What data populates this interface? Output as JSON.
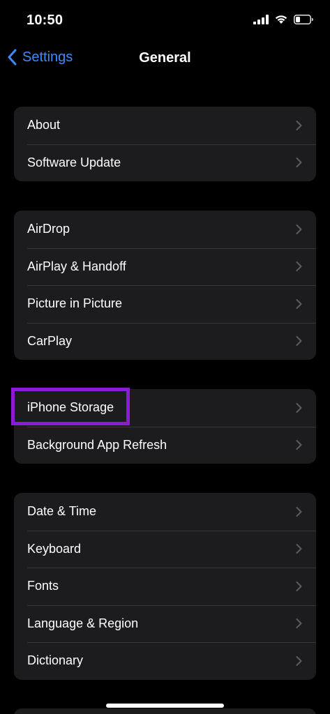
{
  "status_bar": {
    "time": "10:50",
    "icons": [
      "cellular-signal-icon",
      "wifi-icon",
      "battery-icon"
    ]
  },
  "nav": {
    "back_label": "Settings",
    "title": "General",
    "accent_color": "#3e8bff"
  },
  "groups": [
    {
      "items": [
        "About",
        "Software Update"
      ]
    },
    {
      "items": [
        "AirDrop",
        "AirPlay & Handoff",
        "Picture in Picture",
        "CarPlay"
      ]
    },
    {
      "items": [
        "iPhone Storage",
        "Background App Refresh"
      ]
    },
    {
      "items": [
        "Date & Time",
        "Keyboard",
        "Fonts",
        "Language & Region",
        "Dictionary"
      ]
    }
  ],
  "annotation": {
    "highlight_color": "#8a1bd6",
    "highlighted_item": "iPhone Storage"
  }
}
